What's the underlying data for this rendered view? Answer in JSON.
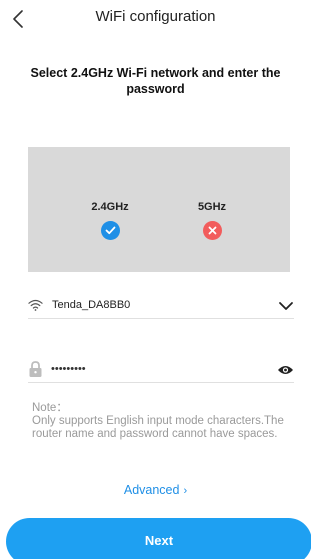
{
  "header": {
    "title": "WiFi configuration",
    "back_icon": "chevron-left-icon"
  },
  "instruction": "Select 2.4GHz Wi-Fi network and enter the password",
  "bands": [
    {
      "label": "2.4GHz",
      "status": "supported",
      "icon": "check-circle-icon",
      "color": "#1f8fe6"
    },
    {
      "label": "5GHz",
      "status": "unsupported",
      "icon": "close-circle-icon",
      "color": "#f25c5c"
    }
  ],
  "network": {
    "name": "Tenda_DA8BB0",
    "icon": "wifi-icon",
    "dropdown_icon": "chevron-down-icon"
  },
  "password": {
    "value": "•••••••••",
    "icon": "lock-icon",
    "visibility_icon": "eye-icon"
  },
  "note": {
    "title": "Note：",
    "text": "Only supports English input mode characters.The router name and password cannot have spaces."
  },
  "advanced": {
    "label": "Advanced",
    "chevron": "›"
  },
  "next_button": {
    "label": "Next"
  },
  "colors": {
    "accent": "#1ea0f2",
    "success": "#1f8fe6",
    "error": "#f25c5c",
    "panel_bg": "#d9d9d9",
    "note_text": "#9a9a9a"
  }
}
